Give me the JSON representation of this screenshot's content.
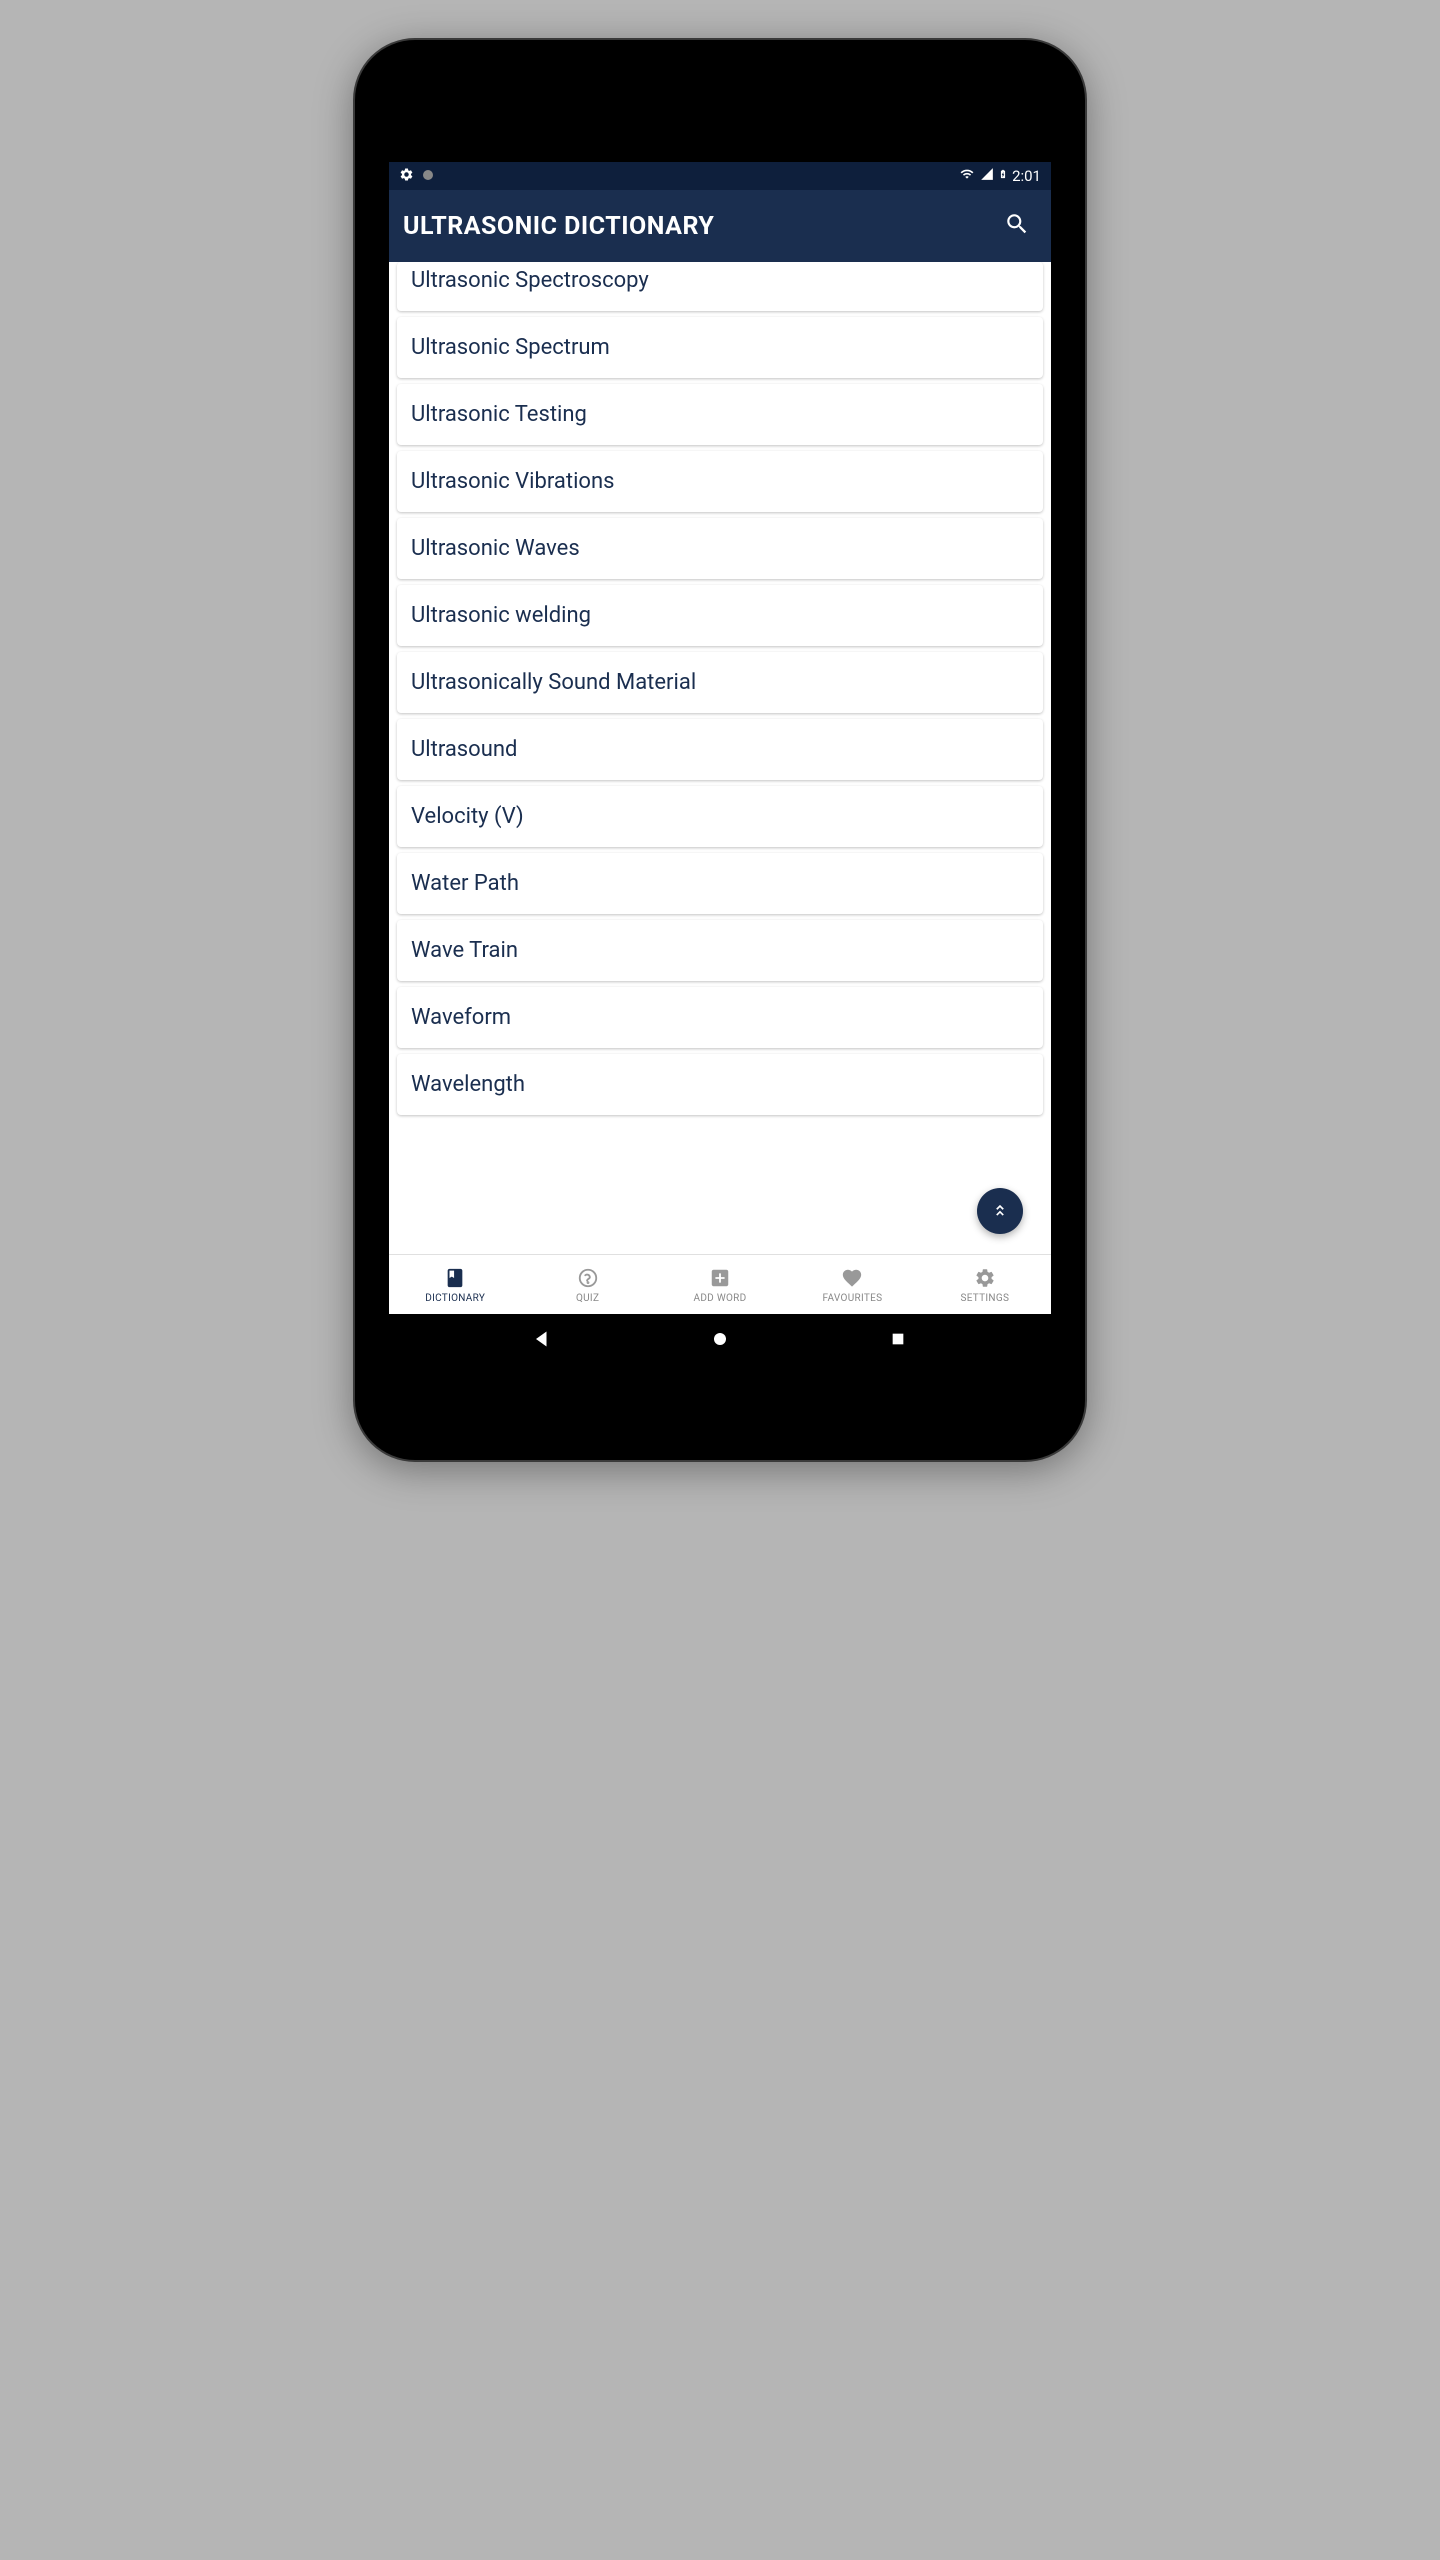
{
  "status": {
    "time": "2:01"
  },
  "header": {
    "title": "ULTRASONIC DICTIONARY"
  },
  "colors": {
    "primary": "#1a2e4f",
    "statusbar": "#0e1f3c",
    "text": "#1a2e4f"
  },
  "list": {
    "items": [
      "Ultrasonic Spectroscopy",
      "Ultrasonic Spectrum",
      "Ultrasonic Testing",
      "Ultrasonic Vibrations",
      "Ultrasonic Waves",
      "Ultrasonic welding",
      "Ultrasonically Sound Material",
      "Ultrasound",
      "Velocity (V)",
      "Water Path",
      "Wave Train",
      "Waveform",
      "Wavelength"
    ]
  },
  "nav": {
    "items": [
      {
        "label": "DICTIONARY",
        "icon": "book",
        "active": true
      },
      {
        "label": "QUIZ",
        "icon": "help",
        "active": false
      },
      {
        "label": "ADD WORD",
        "icon": "plus",
        "active": false
      },
      {
        "label": "FAVOURITES",
        "icon": "heart",
        "active": false
      },
      {
        "label": "SETTINGS",
        "icon": "gear",
        "active": false
      }
    ]
  }
}
